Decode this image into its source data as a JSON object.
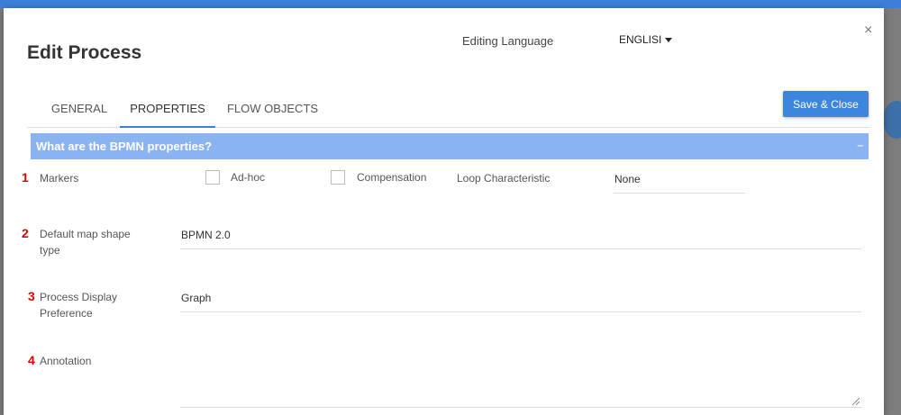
{
  "dialog": {
    "title": "Edit Process",
    "editing_language_label": "Editing Language",
    "language_value": "ENGLISI",
    "close_glyph": "×",
    "save_button": "Save & Close"
  },
  "tabs": [
    {
      "label": "GENERAL",
      "active": false
    },
    {
      "label": "PROPERTIES",
      "active": true
    },
    {
      "label": "FLOW OBJECTS",
      "active": false
    }
  ],
  "section": {
    "title": "What are the BPMN properties?",
    "collapse_glyph": "–"
  },
  "fields": {
    "markers": {
      "number": "1",
      "label": "Markers",
      "adhoc_label": "Ad-hoc",
      "adhoc_checked": false,
      "compensation_label": "Compensation",
      "compensation_checked": false,
      "loop_label": "Loop Characteristic",
      "loop_value": "None"
    },
    "map_shape": {
      "number": "2",
      "label_line1": "Default map shape",
      "label_line2": "type",
      "value": "BPMN 2.0"
    },
    "display_pref": {
      "number": "3",
      "label_line1": "Process Display",
      "label_line2": "Preference",
      "value": "Graph"
    },
    "annotation": {
      "number": "4",
      "label": "Annotation",
      "value": ""
    }
  },
  "colors": {
    "accent": "#3d86e0",
    "section_header": "#8ab3f2",
    "number_marker": "#dd0000"
  }
}
